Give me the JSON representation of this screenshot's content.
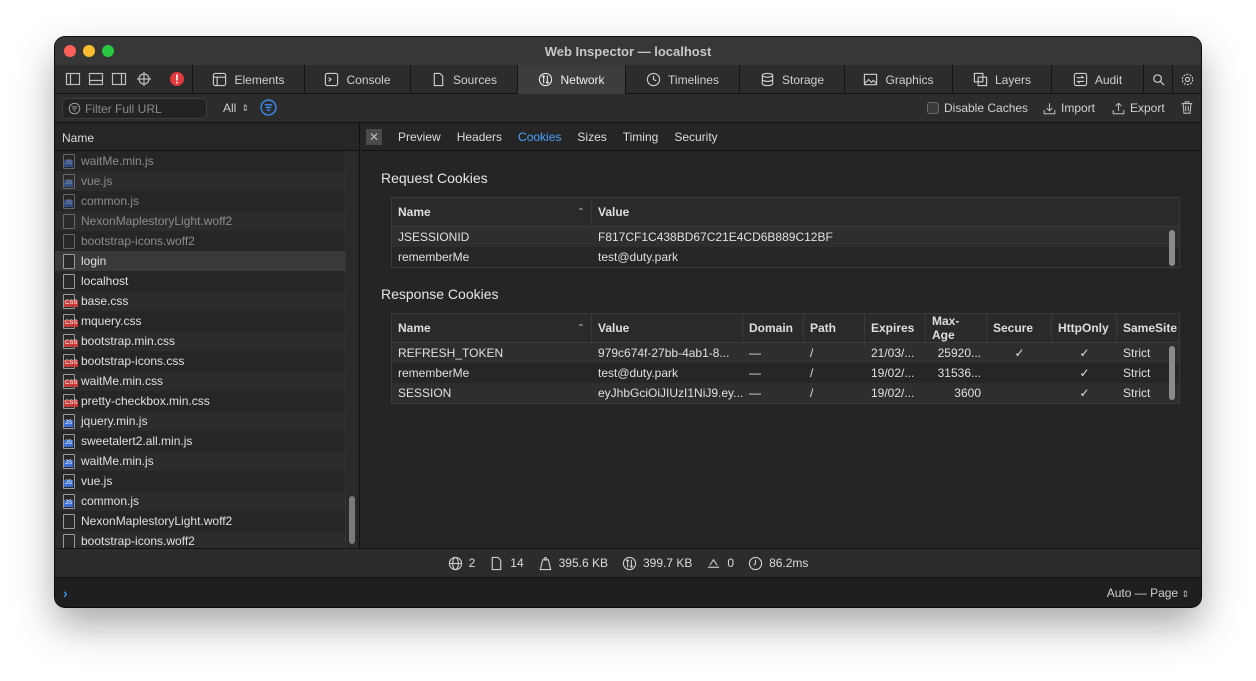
{
  "window": {
    "title": "Web Inspector — localhost"
  },
  "tabs": [
    {
      "label": "Elements",
      "icon": "elements-icon"
    },
    {
      "label": "Console",
      "icon": "console-icon"
    },
    {
      "label": "Sources",
      "icon": "sources-icon"
    },
    {
      "label": "Network",
      "icon": "network-icon",
      "active": true
    },
    {
      "label": "Timelines",
      "icon": "timelines-icon"
    },
    {
      "label": "Storage",
      "icon": "storage-icon"
    },
    {
      "label": "Graphics",
      "icon": "graphics-icon"
    },
    {
      "label": "Layers",
      "icon": "layers-icon"
    },
    {
      "label": "Audit",
      "icon": "audit-icon"
    }
  ],
  "filterbar": {
    "placeholder": "Filter Full URL",
    "type_select": "All",
    "disable_caches": "Disable Caches",
    "import": "Import",
    "export": "Export"
  },
  "left": {
    "header": "Name",
    "files": [
      {
        "name": "waitMe.min.js",
        "type": "js",
        "dim": true
      },
      {
        "name": "vue.js",
        "type": "js",
        "dim": true
      },
      {
        "name": "common.js",
        "type": "js",
        "dim": true
      },
      {
        "name": "NexonMaplestoryLight.woff2",
        "type": "font",
        "dim": true
      },
      {
        "name": "bootstrap-icons.woff2",
        "type": "font",
        "dim": true
      },
      {
        "name": "login",
        "type": "doc",
        "selected": true
      },
      {
        "name": "localhost",
        "type": "doc"
      },
      {
        "name": "base.css",
        "type": "css"
      },
      {
        "name": "mquery.css",
        "type": "css"
      },
      {
        "name": "bootstrap.min.css",
        "type": "css"
      },
      {
        "name": "bootstrap-icons.css",
        "type": "css"
      },
      {
        "name": "waitMe.min.css",
        "type": "css"
      },
      {
        "name": "pretty-checkbox.min.css",
        "type": "css"
      },
      {
        "name": "jquery.min.js",
        "type": "js"
      },
      {
        "name": "sweetalert2.all.min.js",
        "type": "js"
      },
      {
        "name": "waitMe.min.js",
        "type": "js"
      },
      {
        "name": "vue.js",
        "type": "js"
      },
      {
        "name": "common.js",
        "type": "js"
      },
      {
        "name": "NexonMaplestoryLight.woff2",
        "type": "font"
      },
      {
        "name": "bootstrap-icons.woff2",
        "type": "font"
      }
    ]
  },
  "subtabs": [
    "Preview",
    "Headers",
    "Cookies",
    "Sizes",
    "Timing",
    "Security"
  ],
  "request_cookies": {
    "title": "Request Cookies",
    "columns": [
      "Name",
      "Value"
    ],
    "rows": [
      [
        "JSESSIONID",
        "F817CF1C438BD67C21E4CD6B889C12BF"
      ],
      [
        "rememberMe",
        "test@duty.park"
      ]
    ]
  },
  "response_cookies": {
    "title": "Response Cookies",
    "columns": [
      "Name",
      "Value",
      "Domain",
      "Path",
      "Expires",
      "Max-Age",
      "Secure",
      "HttpOnly",
      "SameSite"
    ],
    "rows": [
      [
        "REFRESH_TOKEN",
        "979c674f-27bb-4ab1-8...",
        "—",
        "/",
        "21/03/...",
        "25920...",
        "✓",
        "✓",
        "Strict"
      ],
      [
        "rememberMe",
        "test@duty.park",
        "—",
        "/",
        "19/02/...",
        "31536...",
        "",
        "✓",
        "Strict"
      ],
      [
        "SESSION",
        "eyJhbGciOiJIUzI1NiJ9.ey...",
        "—",
        "/",
        "19/02/...",
        "3600",
        "",
        "✓",
        "Strict"
      ]
    ]
  },
  "status": {
    "domains": "2",
    "resources": "14",
    "transferred": "395.6 KB",
    "size": "399.7 KB",
    "redirects": "0",
    "time": "86.2ms"
  },
  "console": {
    "prompt": "›",
    "context": "Auto — Page"
  }
}
